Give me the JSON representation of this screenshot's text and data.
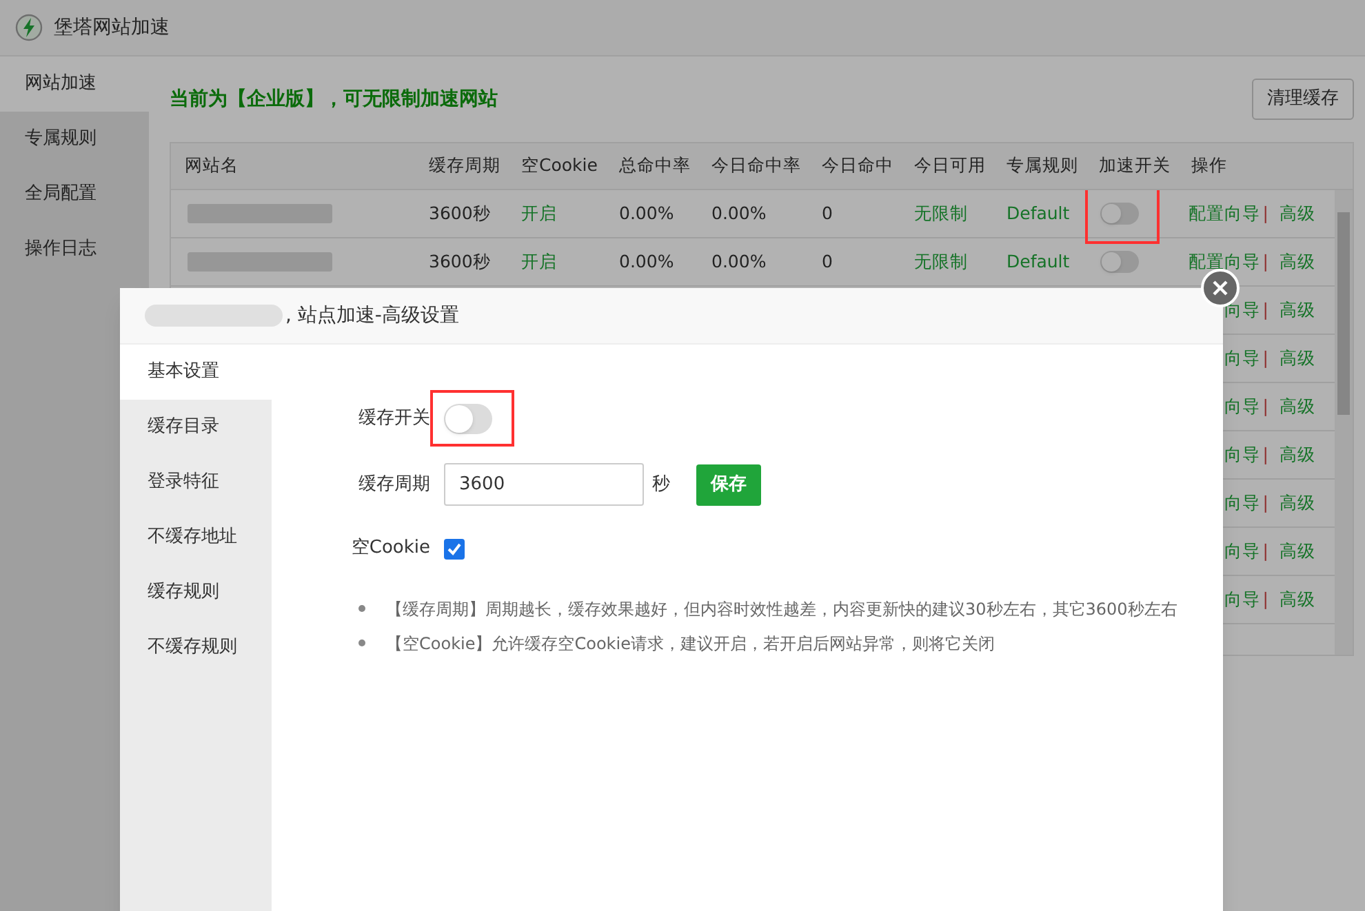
{
  "app": {
    "title": "堡塔网站加速"
  },
  "nav": [
    {
      "label": "网站加速",
      "selected": true
    },
    {
      "label": "专属规则",
      "selected": false
    },
    {
      "label": "全局配置",
      "selected": false
    },
    {
      "label": "操作日志",
      "selected": false
    }
  ],
  "notice": "当前为【企业版】，可无限制加速网站",
  "clear_button": "清理缓存",
  "table": {
    "columns": [
      "网站名",
      "缓存周期",
      "空Cookie",
      "总命中率",
      "今日命中率",
      "今日命中",
      "今日可用",
      "专属规则",
      "加速开关",
      "操作"
    ],
    "rows": [
      {
        "kind": "full",
        "cache_period": "3600秒",
        "empty_cookie": "开启",
        "total_hit_rate": "0.00%",
        "today_hit_rate": "0.00%",
        "today_hits": "0",
        "today_available": "无限制",
        "rule": "Default",
        "on": false,
        "highlighted": true,
        "link_1": "配置向导",
        "separator": "|",
        "link_2": "高级"
      },
      {
        "kind": "full",
        "cache_period": "3600秒",
        "empty_cookie": "开启",
        "total_hit_rate": "0.00%",
        "today_hit_rate": "0.00%",
        "today_hits": "0",
        "today_available": "无限制",
        "rule": "Default",
        "on": false,
        "highlighted": false,
        "link_1": "配置向导",
        "separator": "|",
        "link_2": "高级"
      },
      {
        "kind": "covered",
        "link_1": "向导",
        "separator": "|",
        "link_2": "高级"
      },
      {
        "kind": "covered",
        "link_1": "向导",
        "separator": "|",
        "link_2": "高级"
      },
      {
        "kind": "covered",
        "link_1": "向导",
        "separator": "|",
        "link_2": "高级"
      },
      {
        "kind": "covered",
        "link_1": "向导",
        "separator": "|",
        "link_2": "高级"
      },
      {
        "kind": "covered",
        "link_1": "向导",
        "separator": "|",
        "link_2": "高级"
      },
      {
        "kind": "covered",
        "link_1": "向导",
        "separator": "|",
        "link_2": "高级"
      },
      {
        "kind": "covered",
        "link_1": "向导",
        "separator": "|",
        "link_2": "高级"
      }
    ]
  },
  "modal": {
    "title": ", 站点加速-高级设置",
    "menu": [
      {
        "label": "基本设置",
        "selected": true
      },
      {
        "label": "缓存目录",
        "selected": false
      },
      {
        "label": "登录特征",
        "selected": false
      },
      {
        "label": "不缓存地址",
        "selected": false
      },
      {
        "label": "缓存规则",
        "selected": false
      },
      {
        "label": "不缓存规则",
        "selected": false
      }
    ],
    "cache_switch": {
      "label": "缓存开关",
      "on": false,
      "highlighted": true
    },
    "cache_period": {
      "label": "缓存周期",
      "value": "3600",
      "unit": "秒"
    },
    "save_button": "保存",
    "empty_cookie": {
      "label": "空Cookie",
      "checked": true
    },
    "notes": [
      "【缓存周期】周期越长，缓存效果越好，但内容时效性越差，内容更新快的建议30秒左右，其它3600秒左右",
      "【空Cookie】允许缓存空Cookie请求，建议开启，若开启后网站异常，则将它关闭"
    ]
  }
}
